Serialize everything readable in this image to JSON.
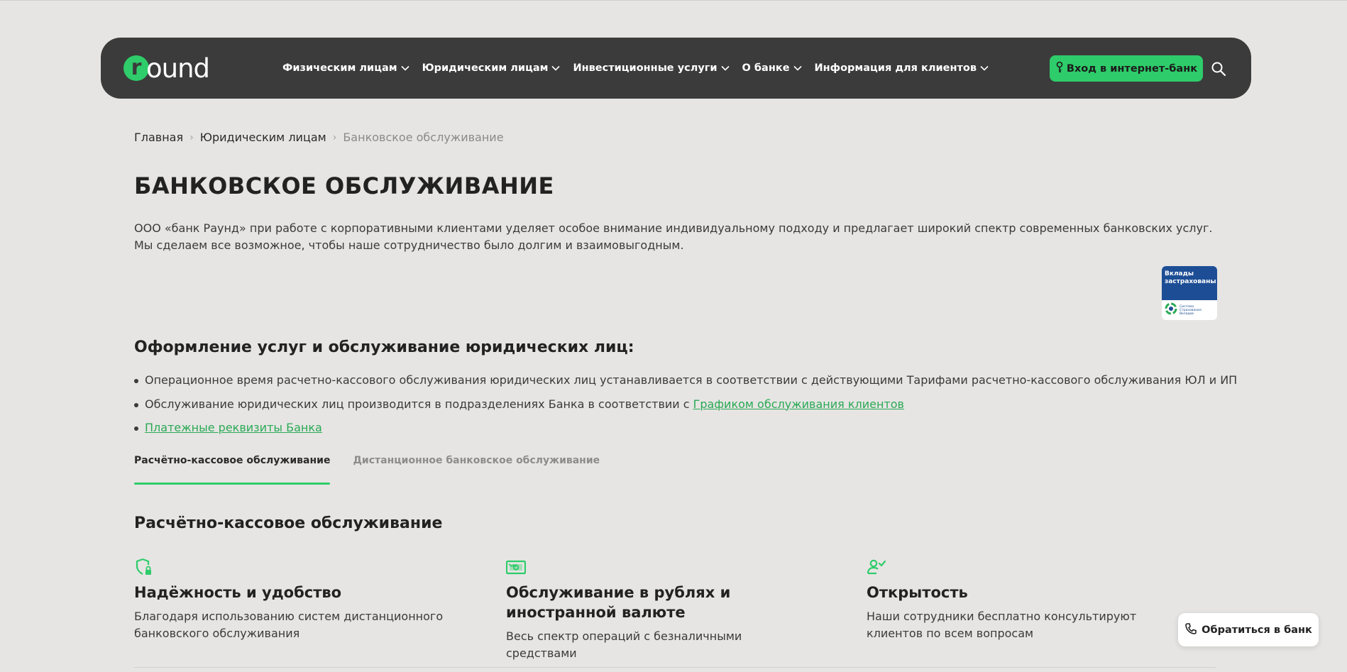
{
  "header": {
    "logo_text": "round",
    "nav": [
      {
        "label": "Физическим лицам"
      },
      {
        "label": "Юридическим лицам"
      },
      {
        "label": "Инвестиционные услуги"
      },
      {
        "label": "О банке"
      },
      {
        "label": "Информация для клиентов"
      }
    ],
    "login_label": "Вход в интернет-банк",
    "search_icon": "search-icon"
  },
  "breadcrumb": {
    "items": [
      "Главная",
      "Юридическим лицам"
    ],
    "current": "Банковское обслуживание"
  },
  "page": {
    "title": "БАНКОВСКОЕ ОБСЛУЖИВАНИЕ",
    "intro": "ООО «банк Раунд» при работе с корпоративными клиентами уделяет особое внимание индивидуальному подходу и предлагает широкий спектр современных банковских услуг. Мы сделаем все возможное, чтобы наше сотрудничество было долгим и взаимовыгодным."
  },
  "badge": {
    "top_text": "Вклады застрахованы",
    "bottom_text": "Система Страхования Вкладов"
  },
  "services": {
    "title": "Оформление услуг и обслуживание юридических лиц:",
    "bullet_1": "Операционное время расчетно-кассового обслуживания юридических лиц устанавливается в соответствии с действующими Тарифами расчетно-кассового обслуживания ЮЛ и ИП",
    "bullet_2_text": "Обслуживание юридических лиц производится в подразделениях Банка в соответствии с ",
    "bullet_2_link": "Графиком обслуживания клиентов",
    "bullet_3_link": "Платежные реквизиты Банка"
  },
  "tabs": [
    {
      "label": "Расчётно-кассовое обслуживание",
      "active": true
    },
    {
      "label": "Дистанционное банковское обслуживание",
      "active": false
    }
  ],
  "rko": {
    "title": "Расчётно-кассовое обслуживание",
    "features": [
      {
        "icon": "shield-lock-icon",
        "title": "Надёжность и удобство",
        "text": "Благодаря использованию систем дистанционного банковского обслуживания"
      },
      {
        "icon": "banknote-icon",
        "title": "Обслуживание в рублях и иностранной валюте",
        "text": "Весь спектр операций с безналичными средствами"
      },
      {
        "icon": "user-check-icon",
        "title": "Открытость",
        "text": "Наши сотрудники бесплатно консультируют клиентов по всем вопросам"
      }
    ]
  },
  "contact_button": {
    "label": "Обратиться в банк",
    "icon": "phone-icon"
  },
  "colors": {
    "accent": "#2ecc6a",
    "header_bg": "#3b3b3b",
    "page_bg": "#e6e5e3",
    "link": "#2aa955"
  }
}
